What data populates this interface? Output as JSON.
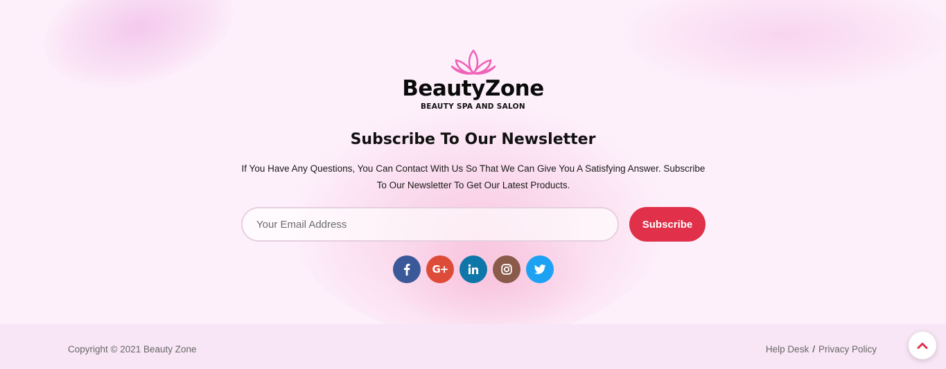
{
  "brand": {
    "name": "BeautyZone",
    "tagline": "BEAUTY SPA AND SALON",
    "icon": "lotus-icon",
    "icon_color": "#f062b8"
  },
  "newsletter": {
    "heading": "Subscribe To Our Newsletter",
    "description": "If You Have Any Questions, You Can Contact With Us So That We Can Give You A Satisfying Answer. Subscribe To Our Newsletter To Get Our Latest Products.",
    "email_placeholder": "Your Email Address",
    "email_value": "",
    "button_label": "Subscribe",
    "button_color": "#e0304a"
  },
  "social": [
    {
      "name": "facebook",
      "icon": "facebook-icon",
      "color": "#3b5998"
    },
    {
      "name": "google-plus",
      "icon": "google-plus-icon",
      "color": "#dd4b39"
    },
    {
      "name": "linkedin",
      "icon": "linkedin-icon",
      "color": "#0e76a8"
    },
    {
      "name": "instagram",
      "icon": "instagram-icon",
      "color": "#8a5a4a"
    },
    {
      "name": "twitter",
      "icon": "twitter-icon",
      "color": "#1da1f2"
    }
  ],
  "footer": {
    "copyright": "Copyright © 2021 Beauty Zone",
    "links": [
      "Help Desk",
      "Privacy Policy"
    ],
    "separator": "/",
    "background": "#f8e6f6"
  },
  "scroll_top": {
    "icon": "chevron-up-icon",
    "color": "#e0304a"
  }
}
